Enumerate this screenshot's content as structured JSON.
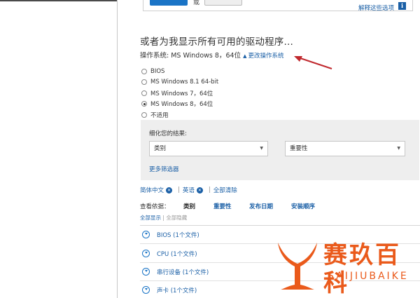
{
  "top": {
    "primary_button": "",
    "or_text": "或",
    "secondary_button": "",
    "explain_link": "解释这些选项",
    "info_icon_glyph": "i"
  },
  "heading": "或者为我显示所有可用的驱动程序...",
  "os": {
    "label": "操作系统: MS Windows 8，64位",
    "change_link": "更改操作系统"
  },
  "os_options": [
    {
      "label": "BIOS",
      "checked": false
    },
    {
      "label": "MS Windows 8.1 64-bit",
      "checked": false
    },
    {
      "label": "MS Windows 7，64位",
      "checked": false
    },
    {
      "label": "MS Windows 8，64位",
      "checked": true
    },
    {
      "label": "不适用",
      "checked": false
    }
  ],
  "refine": {
    "label": "细化您的结果:",
    "category_select": "类别",
    "importance_select": "重要性",
    "more_filters": "更多筛选器"
  },
  "chips": {
    "simplified_chinese": "简体中文",
    "english": "英语",
    "clear_all": "全部清除"
  },
  "view_by": {
    "label": "查看依据：",
    "category": "类别",
    "importance": "重要性",
    "release_date": "发布日期",
    "install_order": "安装顺序"
  },
  "show_all": "全部显示",
  "hide_all": "全部隐藏",
  "files": [
    {
      "label": "BIOS (1个文件)"
    },
    {
      "label": "CPU (1个文件)"
    },
    {
      "label": "串行设备 (1个文件)"
    },
    {
      "label": "声卡 (1个文件)"
    }
  ],
  "watermark": {
    "brand": "赛玖百科",
    "sub": "SAIJIUBAIKE"
  },
  "colors": {
    "link": "#1a5fa6",
    "primary": "#1a74c6",
    "arrow": "#c0282d",
    "watermark": "#ea5a1b",
    "panel": "#eeeeee"
  }
}
